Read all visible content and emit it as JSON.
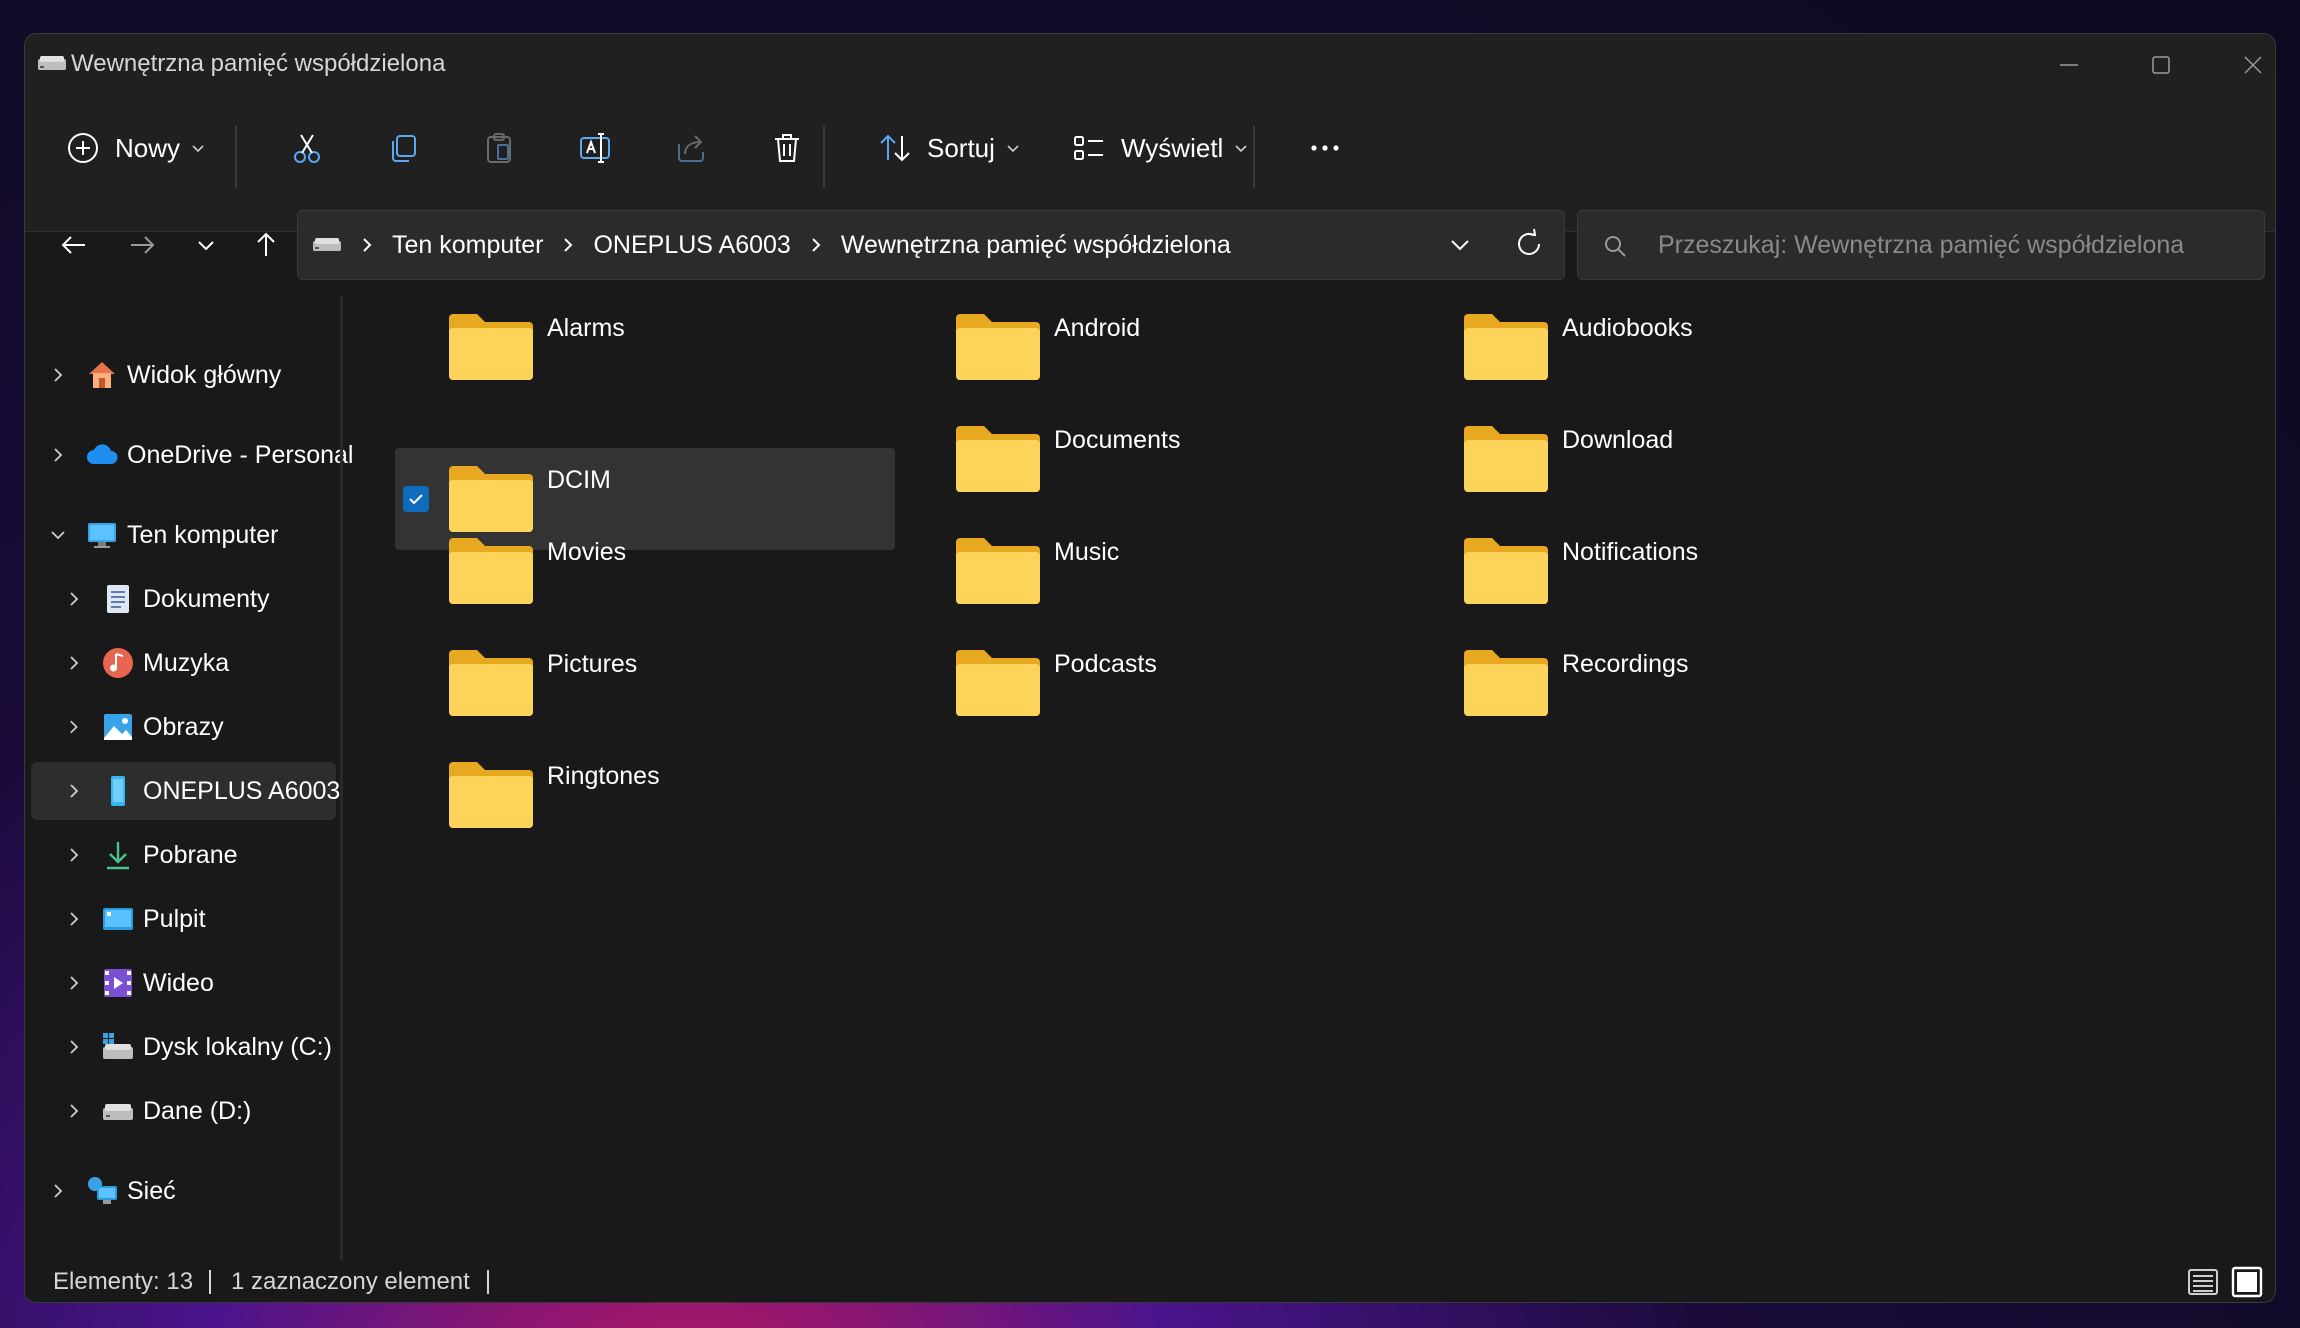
{
  "window": {
    "title": "Wewnętrzna pamięć współdzielona"
  },
  "toolbar": {
    "new_label": "Nowy",
    "sort_label": "Sortuj",
    "view_label": "Wyświetl",
    "more_label": "•••"
  },
  "address": {
    "crumbs": [
      "Ten komputer",
      "ONEPLUS A6003",
      "Wewnętrzna pamięć współdzielona"
    ]
  },
  "search": {
    "placeholder": "Przeszukaj: Wewnętrzna pamięć współdzielona"
  },
  "sidebar": {
    "items": [
      {
        "label": "Widok główny",
        "icon": "home-icon"
      },
      {
        "label": "OneDrive - Personal",
        "icon": "cloud-icon"
      },
      {
        "label": "Ten komputer",
        "icon": "computer-icon"
      },
      {
        "label": "Dokumenty",
        "icon": "documents-icon"
      },
      {
        "label": "Muzyka",
        "icon": "music-icon"
      },
      {
        "label": "Obrazy",
        "icon": "pictures-icon"
      },
      {
        "label": "ONEPLUS A6003",
        "icon": "phone-icon"
      },
      {
        "label": "Pobrane",
        "icon": "download-icon"
      },
      {
        "label": "Pulpit",
        "icon": "desktop-icon"
      },
      {
        "label": "Wideo",
        "icon": "video-icon"
      },
      {
        "label": "Dysk lokalny (C:)",
        "icon": "local-disk-icon"
      },
      {
        "label": "Dane (D:)",
        "icon": "drive-icon"
      },
      {
        "label": "Sieć",
        "icon": "network-icon"
      }
    ]
  },
  "folders": [
    {
      "name": "Alarms"
    },
    {
      "name": "Android"
    },
    {
      "name": "Audiobooks"
    },
    {
      "name": "DCIM"
    },
    {
      "name": "Documents"
    },
    {
      "name": "Download"
    },
    {
      "name": "Movies"
    },
    {
      "name": "Music"
    },
    {
      "name": "Notifications"
    },
    {
      "name": "Pictures"
    },
    {
      "name": "Podcasts"
    },
    {
      "name": "Recordings"
    },
    {
      "name": "Ringtones"
    }
  ],
  "status": {
    "count": "Elementy: 13",
    "selected": "1 zaznaczony element"
  },
  "colors": {
    "accent": "#0f6cbd",
    "folder": "#f8c846",
    "background": "#191919"
  }
}
